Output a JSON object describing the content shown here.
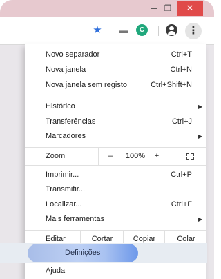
{
  "window": {
    "minimize_glyph": "─",
    "maximize_glyph": "❐",
    "close_glyph": "✕",
    "close_color": "#e04a4a"
  },
  "toolbar": {
    "icons": [
      "star-icon",
      "cast-icon",
      "extension-icon",
      "profile-icon",
      "menu-kebab-icon"
    ],
    "extension_letter": "C",
    "accent_color": "#2f6fdc"
  },
  "menu": {
    "group1": [
      {
        "label": "Novo separador",
        "shortcut": "Ctrl+T"
      },
      {
        "label": "Nova janela",
        "shortcut": "Ctrl+N"
      },
      {
        "label": "Nova janela sem registo",
        "shortcut": "Ctrl+Shift+N"
      }
    ],
    "group2": [
      {
        "label": "Histórico",
        "shortcut": "",
        "submenu": true
      },
      {
        "label": "Transferências",
        "shortcut": "Ctrl+J"
      },
      {
        "label": "Marcadores",
        "shortcut": "",
        "submenu": true
      }
    ],
    "zoom": {
      "label": "Zoom",
      "minus": "–",
      "value": "100%",
      "plus": "+"
    },
    "group3": [
      {
        "label": "Imprimir...",
        "shortcut": "Ctrl+P"
      },
      {
        "label": "Transmitir...",
        "shortcut": ""
      },
      {
        "label": "Localizar...",
        "shortcut": "Ctrl+F"
      },
      {
        "label": "Mais ferramentas",
        "shortcut": "",
        "submenu": true
      }
    ],
    "edit": {
      "label": "Editar",
      "cut": "Cortar",
      "copy": "Copiar",
      "paste": "Colar"
    },
    "settings": {
      "label": "Definições",
      "highlight_color": "#6d98ea"
    },
    "help": {
      "label": "Ajuda",
      "submenu": true
    }
  }
}
